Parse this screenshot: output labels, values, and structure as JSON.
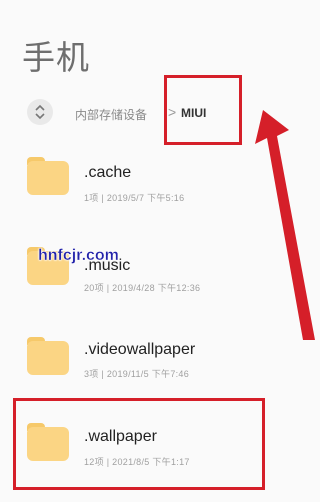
{
  "header": {
    "title": "手机"
  },
  "breadcrumb": {
    "parent": "内部存储设备",
    "separator": ">",
    "current": "MIUI"
  },
  "files": [
    {
      "name": ".cache",
      "meta": "1项 | 2019/5/7 下午5:16"
    },
    {
      "name": ".music",
      "meta": "20项 | 2019/4/28 下午12:36"
    },
    {
      "name": ".videowallpaper",
      "meta": "3项 | 2019/11/5 下午7:46"
    },
    {
      "name": ".wallpaper",
      "meta": "12项 | 2021/8/5 下午1:17"
    }
  ],
  "watermark": {
    "text": "hnfcjr.com"
  },
  "colors": {
    "highlight": "#d51f29",
    "folder": "#fbd584"
  }
}
